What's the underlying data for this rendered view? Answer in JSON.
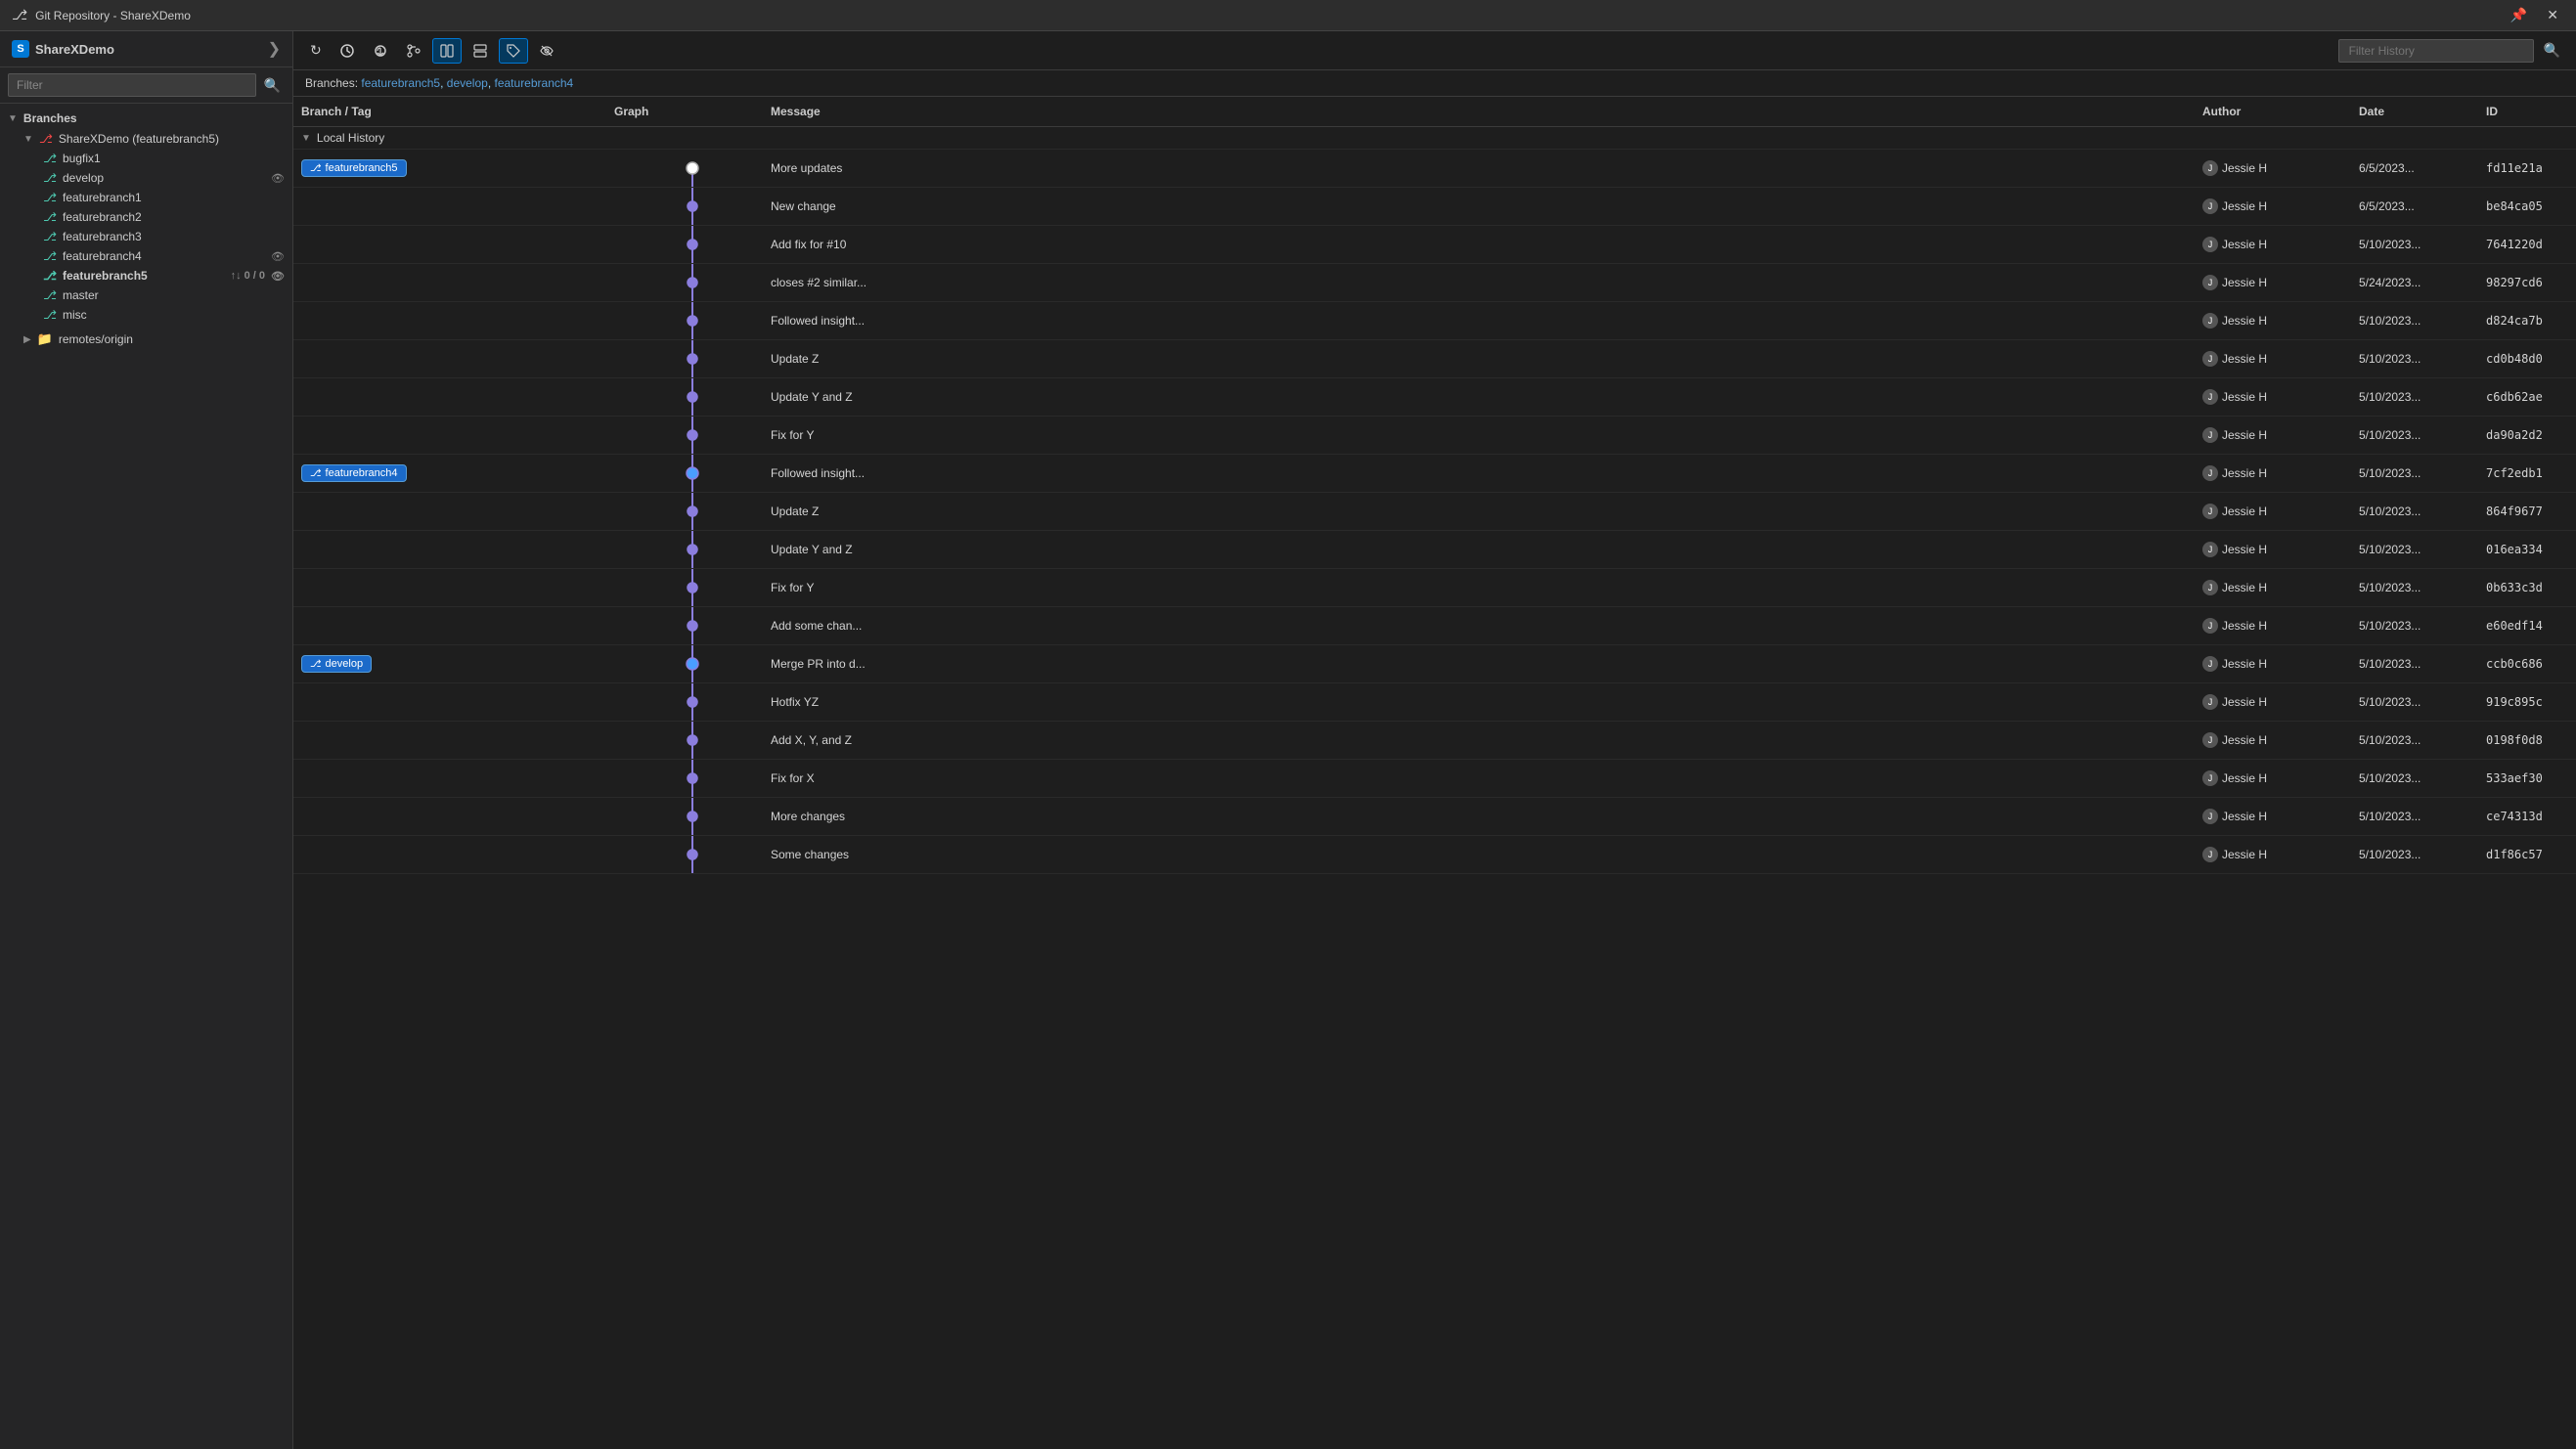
{
  "titleBar": {
    "title": "Git Repository - ShareXDemo",
    "pin": "📌",
    "close": "✕",
    "collapse": "⌄"
  },
  "sidebar": {
    "title": "ShareXDemo",
    "filterPlaceholder": "Filter",
    "sections": [
      {
        "label": "Branches",
        "items": [
          {
            "name": "ShareXDemo (featurebranch5)",
            "level": 0,
            "type": "repo",
            "bold": false
          },
          {
            "name": "bugfix1",
            "level": 1,
            "type": "branch",
            "bold": false
          },
          {
            "name": "develop",
            "level": 1,
            "type": "branch",
            "bold": false,
            "hasEye": true
          },
          {
            "name": "featurebranch1",
            "level": 1,
            "type": "branch",
            "bold": false
          },
          {
            "name": "featurebranch2",
            "level": 1,
            "type": "branch",
            "bold": false
          },
          {
            "name": "featurebranch3",
            "level": 1,
            "type": "branch",
            "bold": false
          },
          {
            "name": "featurebranch4",
            "level": 1,
            "type": "branch",
            "bold": false,
            "hasEye": true
          },
          {
            "name": "featurebranch5",
            "level": 1,
            "type": "branch",
            "bold": true,
            "sync": "↑↓ 0 / 0",
            "hasEye": true
          },
          {
            "name": "master",
            "level": 1,
            "type": "branch",
            "bold": false
          },
          {
            "name": "misc",
            "level": 1,
            "type": "branch",
            "bold": false
          }
        ]
      },
      {
        "label": "remotes/origin",
        "level": 0,
        "type": "remote"
      }
    ]
  },
  "toolbar": {
    "buttons": [
      {
        "id": "refresh",
        "icon": "↻",
        "tooltip": "Refresh",
        "active": false
      },
      {
        "id": "fetch",
        "icon": "⟳",
        "tooltip": "Fetch",
        "active": false
      },
      {
        "id": "pull",
        "icon": "↓",
        "tooltip": "Pull",
        "active": false
      },
      {
        "id": "branches",
        "icon": "⎇",
        "tooltip": "Branches",
        "active": false
      },
      {
        "id": "layout1",
        "icon": "⊞",
        "tooltip": "Layout 1",
        "active": true
      },
      {
        "id": "layout2",
        "icon": "⊟",
        "tooltip": "Layout 2",
        "active": false
      },
      {
        "id": "tag",
        "icon": "◇",
        "tooltip": "Tag",
        "active": true
      },
      {
        "id": "eye",
        "icon": "👁",
        "tooltip": "Eye",
        "active": false
      }
    ],
    "filterPlaceholder": "Filter History",
    "filterSearchIcon": "🔍"
  },
  "branchInfoBar": {
    "prefix": "Branches:",
    "branches": [
      "featurebranch5",
      "develop",
      "featurebranch4"
    ]
  },
  "tableHeaders": [
    "Branch / Tag",
    "Graph",
    "Message",
    "Author",
    "Date",
    "ID"
  ],
  "localHistoryLabel": "Local History",
  "commits": [
    {
      "branchTag": "featurebranch5",
      "graphNode": "top",
      "graphColor": "white",
      "message": "More updates",
      "author": "Jessie H",
      "date": "6/5/2023...",
      "id": "fd11e21a"
    },
    {
      "branchTag": null,
      "graphNode": "mid",
      "graphColor": "purple",
      "message": "New change",
      "author": "Jessie H",
      "date": "6/5/2023...",
      "id": "be84ca05"
    },
    {
      "branchTag": null,
      "graphNode": "mid",
      "graphColor": "purple",
      "message": "Add fix for #10",
      "author": "Jessie H",
      "date": "5/10/2023...",
      "id": "7641220d"
    },
    {
      "branchTag": null,
      "graphNode": "mid",
      "graphColor": "purple",
      "message": "closes #2 similar...",
      "author": "Jessie H",
      "date": "5/24/2023...",
      "id": "98297cd6"
    },
    {
      "branchTag": null,
      "graphNode": "mid",
      "graphColor": "purple",
      "message": "Followed insight...",
      "author": "Jessie H",
      "date": "5/10/2023...",
      "id": "d824ca7b"
    },
    {
      "branchTag": null,
      "graphNode": "mid",
      "graphColor": "purple",
      "message": "Update Z",
      "author": "Jessie H",
      "date": "5/10/2023...",
      "id": "cd0b48d0"
    },
    {
      "branchTag": null,
      "graphNode": "mid",
      "graphColor": "purple",
      "message": "Update Y and Z",
      "author": "Jessie H",
      "date": "5/10/2023...",
      "id": "c6db62ae"
    },
    {
      "branchTag": null,
      "graphNode": "mid",
      "graphColor": "purple",
      "message": "Fix for Y",
      "author": "Jessie H",
      "date": "5/10/2023...",
      "id": "da90a2d2"
    },
    {
      "branchTag": "featurebranch4",
      "graphNode": "branch",
      "graphColor": "blue",
      "message": "Followed insight...",
      "author": "Jessie H",
      "date": "5/10/2023...",
      "id": "7cf2edb1"
    },
    {
      "branchTag": null,
      "graphNode": "mid",
      "graphColor": "purple",
      "message": "Update Z",
      "author": "Jessie H",
      "date": "5/10/2023...",
      "id": "864f9677"
    },
    {
      "branchTag": null,
      "graphNode": "mid",
      "graphColor": "purple",
      "message": "Update Y and Z",
      "author": "Jessie H",
      "date": "5/10/2023...",
      "id": "016ea334"
    },
    {
      "branchTag": null,
      "graphNode": "mid",
      "graphColor": "purple",
      "message": "Fix for Y",
      "author": "Jessie H",
      "date": "5/10/2023...",
      "id": "0b633c3d"
    },
    {
      "branchTag": null,
      "graphNode": "mid",
      "graphColor": "purple",
      "message": "Add some chan...",
      "author": "Jessie H",
      "date": "5/10/2023...",
      "id": "e60edf14"
    },
    {
      "branchTag": "develop",
      "graphNode": "branch",
      "graphColor": "blue",
      "message": "Merge PR into d...",
      "author": "Jessie H",
      "date": "5/10/2023...",
      "id": "ccb0c686"
    },
    {
      "branchTag": null,
      "graphNode": "mid",
      "graphColor": "purple",
      "message": "Hotfix YZ",
      "author": "Jessie H",
      "date": "5/10/2023...",
      "id": "919c895c"
    },
    {
      "branchTag": null,
      "graphNode": "mid",
      "graphColor": "purple",
      "message": "Add X, Y, and Z",
      "author": "Jessie H",
      "date": "5/10/2023...",
      "id": "0198f0d8"
    },
    {
      "branchTag": null,
      "graphNode": "mid",
      "graphColor": "purple",
      "message": "Fix for X",
      "author": "Jessie H",
      "date": "5/10/2023...",
      "id": "533aef30"
    },
    {
      "branchTag": null,
      "graphNode": "mid",
      "graphColor": "purple",
      "message": "More changes",
      "author": "Jessie H",
      "date": "5/10/2023...",
      "id": "ce74313d"
    },
    {
      "branchTag": null,
      "graphNode": "mid",
      "graphColor": "purple",
      "message": "Some changes",
      "author": "Jessie H",
      "date": "5/10/2023...",
      "id": "d1f86c57"
    }
  ],
  "colors": {
    "purpleLine": "#8b7ede",
    "blueNode": "#4a9eff",
    "whiteNode": "#ffffff",
    "branchTag": "#1b6ac9"
  }
}
